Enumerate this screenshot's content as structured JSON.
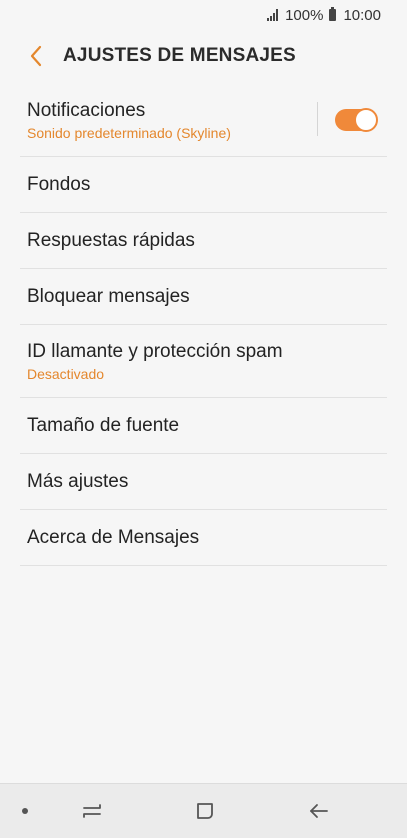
{
  "status_bar": {
    "battery": "100%",
    "time": "10:00"
  },
  "header": {
    "back_icon": "chevron-left-icon",
    "title": "AJUSTES DE MENSAJES"
  },
  "accent_color": "#f0893a",
  "settings": [
    {
      "title": "Notificaciones",
      "subtitle": "Sonido predeterminado (Skyline)",
      "toggle": true
    },
    {
      "title": "Fondos"
    },
    {
      "title": "Respuestas rápidas"
    },
    {
      "title": "Bloquear mensajes"
    },
    {
      "title": "ID llamante y protección spam",
      "subtitle": "Desactivado"
    },
    {
      "title": "Tamaño de fuente"
    },
    {
      "title": "Más ajustes"
    },
    {
      "title": "Acerca de Mensajes"
    }
  ],
  "nav_bar": {
    "icons": [
      "dot-icon",
      "recent-apps-icon",
      "home-icon",
      "back-icon"
    ]
  }
}
